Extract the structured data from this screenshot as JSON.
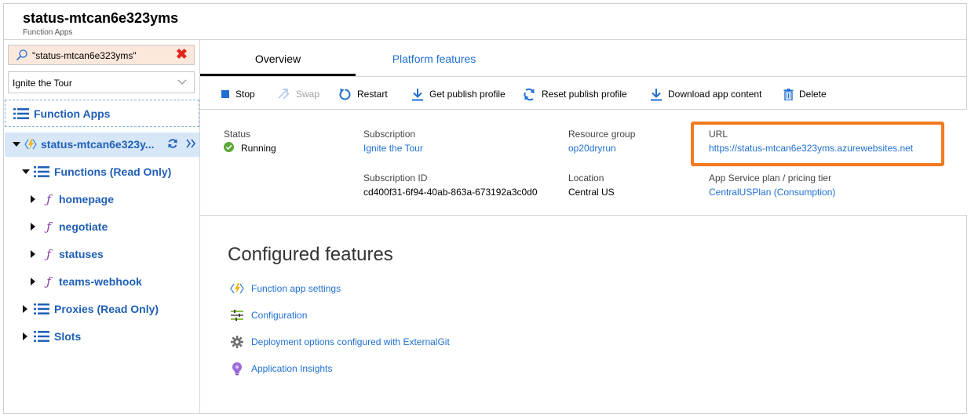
{
  "header": {
    "title": "status-mtcan6e323yms",
    "subtitle": "Function Apps"
  },
  "sidebar": {
    "search_value": "\"status-mtcan6e323yms\"",
    "subscription_select": "Ignite the Tour",
    "function_apps_label": "Function Apps",
    "app_label": "status-mtcan6e323y...",
    "functions_label": "Functions (Read Only)",
    "functions": [
      "homepage",
      "negotiate",
      "statuses",
      "teams-webhook"
    ],
    "proxies_label": "Proxies (Read Only)",
    "slots_label": "Slots"
  },
  "tabs": {
    "overview": "Overview",
    "platform": "Platform features"
  },
  "toolbar": {
    "stop": "Stop",
    "swap": "Swap",
    "restart": "Restart",
    "get_publish_profile": "Get publish profile",
    "reset_publish_profile": "Reset publish profile",
    "download_app_content": "Download app content",
    "delete": "Delete"
  },
  "info": {
    "status_label": "Status",
    "status_value": "Running",
    "subscription_label": "Subscription",
    "subscription_value": "Ignite the Tour",
    "subscription_id_label": "Subscription ID",
    "subscription_id_value": "cd400f31-6f94-40ab-863a-673192a3c0d0",
    "resource_group_label": "Resource group",
    "resource_group_value": "op20dryrun",
    "location_label": "Location",
    "location_value": "Central US",
    "url_label": "URL",
    "url_value": "https://status-mtcan6e323yms.azurewebsites.net",
    "plan_label": "App Service plan / pricing tier",
    "plan_value": "CentralUSPlan (Consumption)"
  },
  "features": {
    "title": "Configured features",
    "items": [
      "Function app settings",
      "Configuration",
      "Deployment options configured with ExternalGit",
      "Application Insights"
    ]
  },
  "colors": {
    "link": "#1f6fd1",
    "highlight": "#f47a1f",
    "running": "#5ba839",
    "selected_row": "#d7e7f8"
  }
}
